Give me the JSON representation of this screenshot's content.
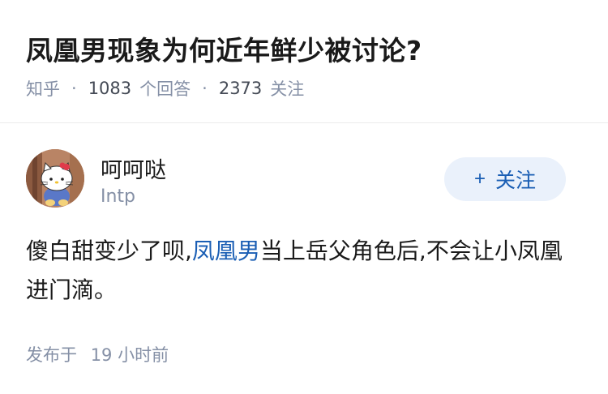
{
  "question": {
    "title": "凤凰男现象为何近年鲜少被讨论?",
    "source": "知乎",
    "answer_count": "1083",
    "answer_label": "个回答",
    "follower_count": "2373",
    "follower_label": "关注"
  },
  "author": {
    "name": "呵呵哒",
    "bio": "Intp",
    "avatar_icon": "hello-kitty-avatar",
    "follow_button_label": "关注"
  },
  "answer": {
    "text_before": "傻白甜变少了呗,",
    "link_text": "凤凰男",
    "text_after": "当上岳父角色后,不会让小凤凰进门滴。",
    "link_color": "#1a5eb4"
  },
  "footer": {
    "published_label": "发布于",
    "time_value": "19",
    "time_unit": "小时前"
  }
}
